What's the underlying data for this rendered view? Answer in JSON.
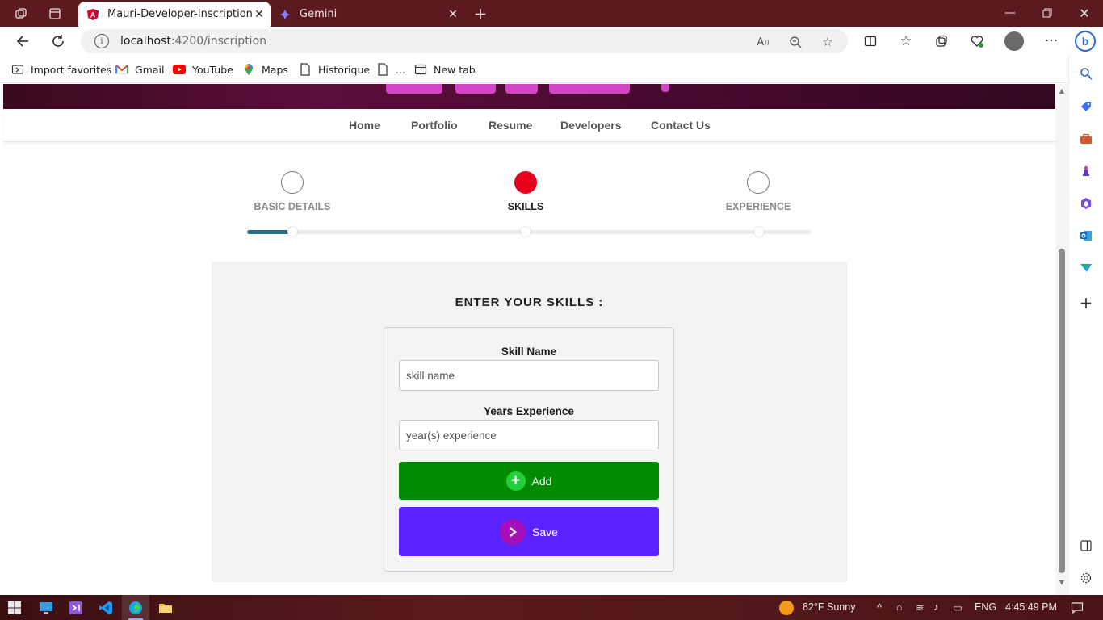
{
  "browser": {
    "tabs": [
      {
        "title": "Mauri-Developer-Inscription",
        "active": true,
        "favicon": "angular-icon"
      },
      {
        "title": "Gemini",
        "active": false,
        "favicon": "gemini-sparkle-icon"
      }
    ],
    "url_host": "localhost",
    "url_rest": ":4200/inscription",
    "favorites": [
      {
        "label": "Import favorites",
        "icon": "import-icon"
      },
      {
        "label": "Gmail",
        "icon": "gmail-icon"
      },
      {
        "label": "YouTube",
        "icon": "youtube-icon"
      },
      {
        "label": "Maps",
        "icon": "maps-icon"
      },
      {
        "label": "Historique",
        "icon": "page-icon"
      },
      {
        "label": "...",
        "icon": "page-icon"
      },
      {
        "label": "New tab",
        "icon": "newtab-icon"
      }
    ]
  },
  "site": {
    "nav": [
      "Home",
      "Portfolio",
      "Resume",
      "Developers",
      "Contact Us"
    ]
  },
  "stepper": {
    "steps": [
      {
        "label": "BASIC DETAILS",
        "active": false
      },
      {
        "label": "SKILLS",
        "active": true
      },
      {
        "label": "EXPERIENCE",
        "active": false
      }
    ],
    "progress_fraction": 0.08,
    "active_color": "#e8001f",
    "progress_color": "#2b6e8c"
  },
  "form": {
    "title": "ENTER YOUR SKILLS :",
    "skill_label": "Skill Name",
    "skill_placeholder": "skill name",
    "years_label": "Years Experience",
    "years_placeholder": "year(s) experience",
    "add_label": "Add",
    "save_label": "Save",
    "add_color": "#008c00",
    "save_color": "#5b22ff"
  },
  "taskbar": {
    "weather": "82°F  Sunny",
    "language": "ENG",
    "time": "4:45:49 PM"
  }
}
